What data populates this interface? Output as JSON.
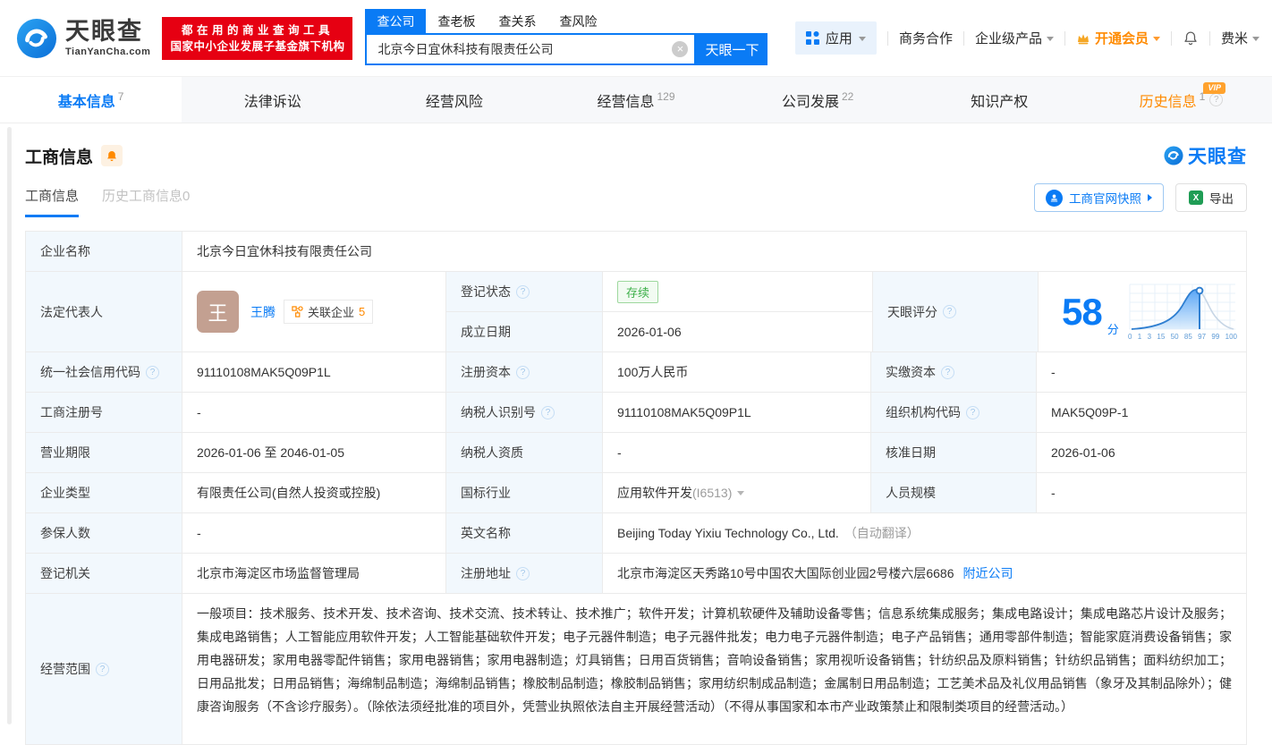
{
  "icons": {
    "help": "?",
    "clear": "×"
  },
  "brand": {
    "name": "天眼查",
    "domain": "TianYanCha.com",
    "promo1": "都在用的商业查询工具",
    "promo2": "国家中小企业发展子基金旗下机构"
  },
  "search": {
    "tab_company": "查公司",
    "tab_boss": "查老板",
    "tab_relation": "查关系",
    "tab_risk": "查风险",
    "value": "北京今日宜休科技有限责任公司",
    "button": "天眼一下"
  },
  "topmenu": {
    "apps": "应用",
    "cooperation": "商务合作",
    "enterprise": "企业级产品",
    "vip": "开通会员",
    "username": "费米"
  },
  "nav": {
    "vip_badge": "VIP",
    "tabs": [
      {
        "label": "基本信息",
        "count": "7"
      },
      {
        "label": "法律诉讼",
        "count": ""
      },
      {
        "label": "经营风险",
        "count": ""
      },
      {
        "label": "经营信息",
        "count": "129"
      },
      {
        "label": "公司发展",
        "count": "22"
      },
      {
        "label": "知识产权",
        "count": ""
      },
      {
        "label": "历史信息",
        "count": "1"
      }
    ]
  },
  "section": {
    "title": "工商信息",
    "subtab_current": "工商信息",
    "subtab_history": "历史工商信息0",
    "snapshot": "工商官网快照",
    "export": "导出",
    "brand": "天眼查"
  },
  "company": {
    "name_label": "企业名称",
    "name": "北京今日宜休科技有限责任公司",
    "legal_rep_label": "法定代表人",
    "legal_rep_avatar": "王",
    "legal_rep_name": "王腾",
    "related_label": "关联企业",
    "related_count": "5"
  },
  "score": {
    "label": "天眼评分",
    "value": "58",
    "unit": "分",
    "axis": [
      "0",
      "1",
      "3",
      "15",
      "50",
      "85",
      "97",
      "99",
      "100"
    ]
  },
  "fields": {
    "reg_status": {
      "label": "登记状态",
      "value": "存续"
    },
    "establish_date": {
      "label": "成立日期",
      "value": "2026-01-06"
    },
    "credit_code": {
      "label": "统一社会信用代码",
      "value": "91110108MAK5Q09P1L"
    },
    "reg_capital": {
      "label": "注册资本",
      "value": "100万人民币"
    },
    "paid_capital": {
      "label": "实缴资本",
      "value": "-"
    },
    "reg_number": {
      "label": "工商注册号",
      "value": "-"
    },
    "taxpayer_id": {
      "label": "纳税人识别号",
      "value": "91110108MAK5Q09P1L"
    },
    "org_code": {
      "label": "组织机构代码",
      "value": "MAK5Q09P-1"
    },
    "business_term": {
      "label": "营业期限",
      "value": "2026-01-06 至 2046-01-05"
    },
    "taxpayer_quals": {
      "label": "纳税人资质",
      "value": "-"
    },
    "approval_date": {
      "label": "核准日期",
      "value": "2026-01-06"
    },
    "company_type": {
      "label": "企业类型",
      "value": "有限责任公司(自然人投资或控股)"
    },
    "industry": {
      "label": "国标行业",
      "value": "应用软件开发",
      "code": "(I6513)"
    },
    "staff_size": {
      "label": "人员规模",
      "value": "-"
    },
    "insured_count": {
      "label": "参保人数",
      "value": "-"
    },
    "english_name": {
      "label": "英文名称",
      "value": "Beijing Today Yixiu Technology Co., Ltd.",
      "note": "（自动翻译）"
    },
    "reg_authority": {
      "label": "登记机关",
      "value": "北京市海淀区市场监督管理局"
    },
    "reg_address": {
      "label": "注册地址",
      "value": "北京市海淀区天秀路10号中国农大国际创业园2号楼六层6686",
      "link": "附近公司"
    },
    "business_scope": {
      "label": "经营范围",
      "value": "一般项目：技术服务、技术开发、技术咨询、技术交流、技术转让、技术推广；软件开发；计算机软硬件及辅助设备零售；信息系统集成服务；集成电路设计；集成电路芯片设计及服务；集成电路销售；人工智能应用软件开发；人工智能基础软件开发；电子元器件制造；电子元器件批发；电力电子元器件制造；电子产品销售；通用零部件制造；智能家庭消费设备销售；家用电器研发；家用电器零配件销售；家用电器销售；家用电器制造；灯具销售；日用百货销售；音响设备销售；家用视听设备销售；针纺织品及原料销售；针纺织品销售；面料纺织加工；日用品批发；日用品销售；海绵制品制造；海绵制品销售；橡胶制品制造；橡胶制品销售；家用纺织制成品制造；金属制日用品制造；工艺美术品及礼仪用品销售（象牙及其制品除外）；健康咨询服务（不含诊疗服务）。（除依法须经批准的项目外，凭营业执照依法自主开展经营活动）（不得从事国家和本市产业政策禁止和限制类项目的经营活动。）"
    }
  }
}
